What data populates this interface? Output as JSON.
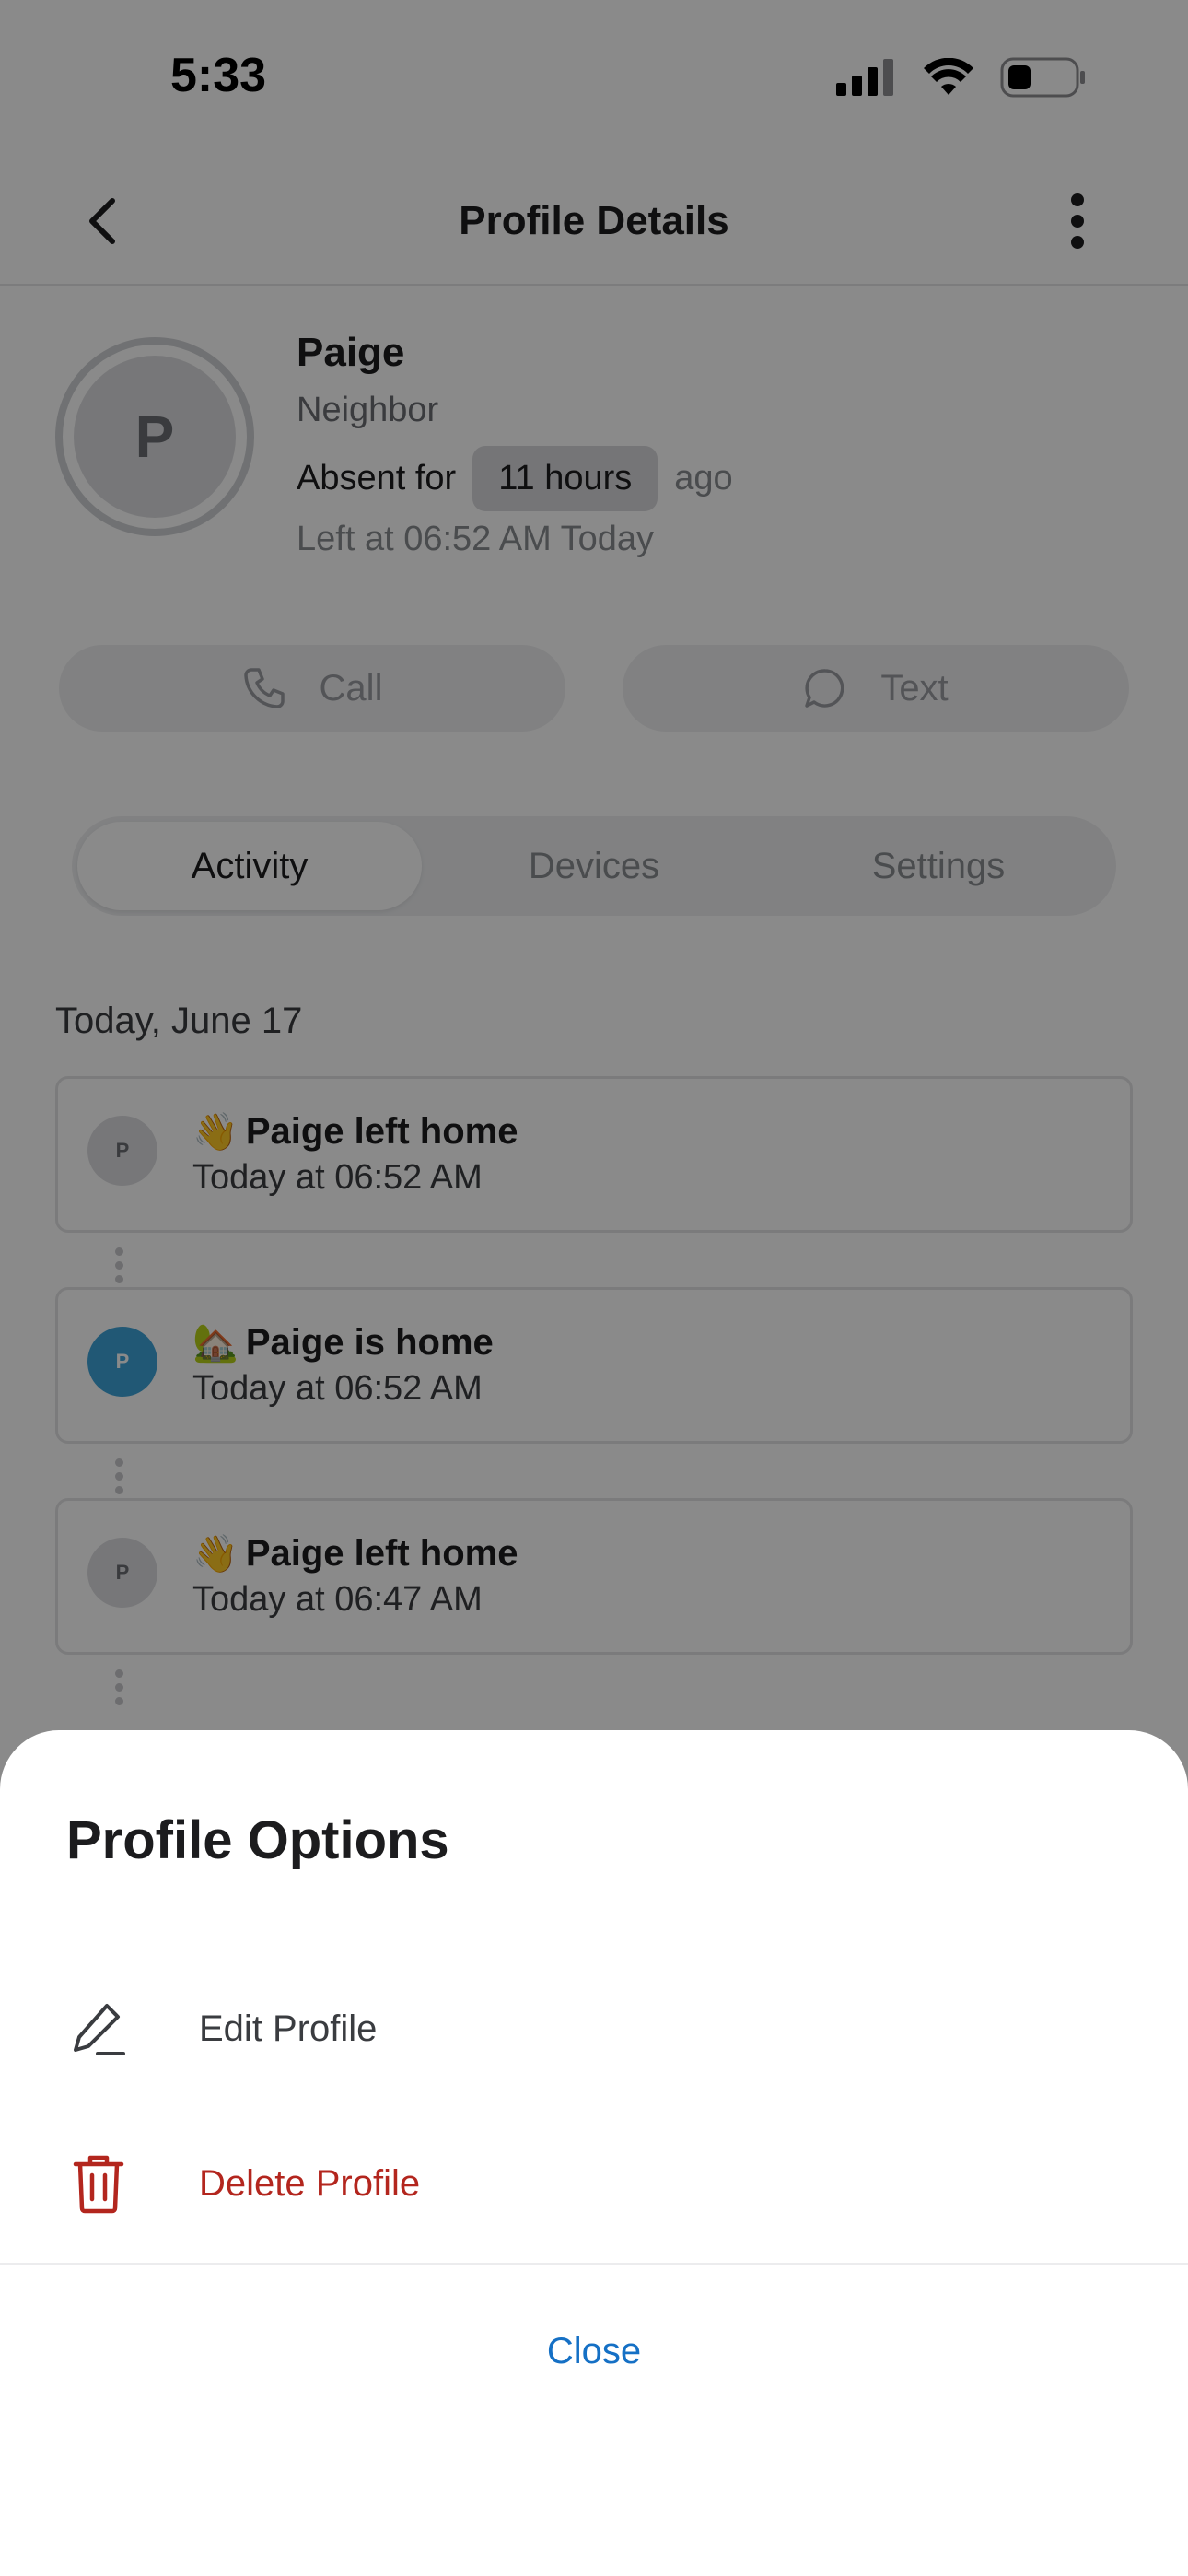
{
  "status_bar": {
    "time": "5:33"
  },
  "header": {
    "title": "Profile Details"
  },
  "profile": {
    "initial": "P",
    "name": "Paige",
    "role": "Neighbor",
    "absent_label": "Absent for",
    "absent_duration": "11 hours",
    "absent_suffix": "ago",
    "left_at": "Left at 06:52 AM Today"
  },
  "actions": {
    "call_label": "Call",
    "text_label": "Text"
  },
  "tabs": [
    {
      "label": "Activity",
      "active": true
    },
    {
      "label": "Devices",
      "active": false
    },
    {
      "label": "Settings",
      "active": false
    }
  ],
  "activity": {
    "date_heading": "Today, June 17",
    "items": [
      {
        "avatar_initial": "P",
        "avatar_color": "#dcdde0",
        "emoji": "👋",
        "title": "Paige left home",
        "time": "Today at 06:52 AM"
      },
      {
        "avatar_initial": "P",
        "avatar_color": "#3ea3d8",
        "emoji": "🏡",
        "title": "Paige is home",
        "time": "Today at 06:52 AM"
      },
      {
        "avatar_initial": "P",
        "avatar_color": "#dcdde0",
        "emoji": "👋",
        "title": "Paige left home",
        "time": "Today at 06:47 AM"
      }
    ]
  },
  "sheet": {
    "title": "Profile Options",
    "edit_label": "Edit Profile",
    "delete_label": "Delete Profile",
    "close_label": "Close"
  },
  "colors": {
    "accent_blue": "#1570c5",
    "destructive_red": "#b3261e",
    "avatar_blue": "#3ea3d8"
  }
}
